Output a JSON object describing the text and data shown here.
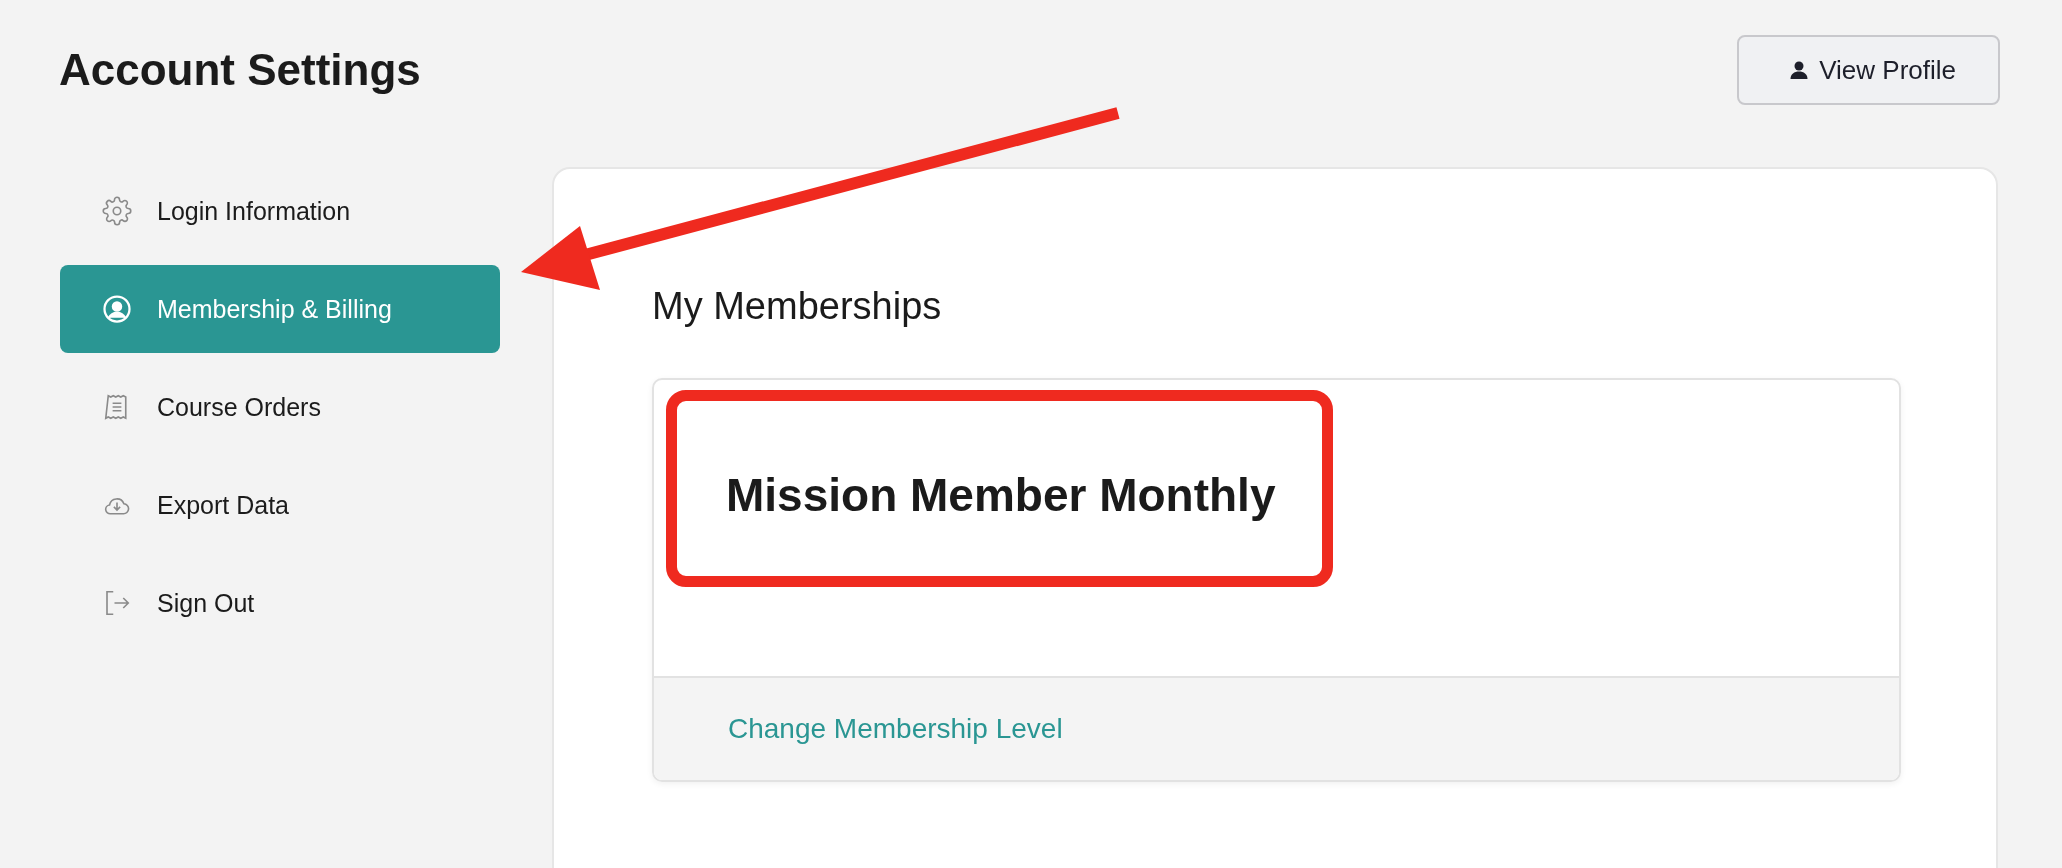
{
  "page": {
    "title": "Account Settings"
  },
  "header": {
    "view_profile_button": "View Profile"
  },
  "sidebar": {
    "items": [
      {
        "label": "Login Information",
        "selected": false
      },
      {
        "label": "Membership & Billing",
        "selected": true
      },
      {
        "label": "Course Orders",
        "selected": false
      },
      {
        "label": "Export Data",
        "selected": false
      },
      {
        "label": "Sign Out",
        "selected": false
      }
    ]
  },
  "main": {
    "heading": "My Memberships",
    "membership_card": {
      "name": "Mission Member Monthly",
      "link": "Change Membership Level"
    }
  },
  "annotations": {
    "arrow": true,
    "highlight_box": true
  }
}
